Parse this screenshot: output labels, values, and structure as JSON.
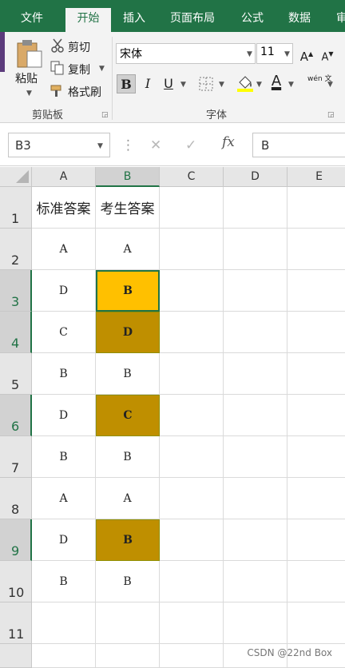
{
  "ribbon_tabs": [
    "文件",
    "开始",
    "插入",
    "页面布局",
    "公式",
    "数据",
    "审"
  ],
  "active_tab": "开始",
  "clipboard": {
    "paste_label": "粘贴",
    "cut_label": "剪切",
    "copy_label": "复制",
    "format_painter_label": "格式刷",
    "group_label": "剪贴板"
  },
  "font": {
    "name": "宋体",
    "size": "11",
    "bold_label": "B",
    "italic_label": "I",
    "underline_label": "U",
    "font_color_label": "A",
    "phonetic_label": "wén 文",
    "group_label": "字体"
  },
  "formula_bar": {
    "name_box": "B3",
    "fx_label": "fx",
    "value": "B"
  },
  "columns": [
    "A",
    "B",
    "C",
    "D",
    "E"
  ],
  "rows": [
    {
      "num": "1",
      "a": "标准答案",
      "b": "考生答案"
    },
    {
      "num": "2",
      "a": "A",
      "b": "A"
    },
    {
      "num": "3",
      "a": "D",
      "b": "B"
    },
    {
      "num": "4",
      "a": "C",
      "b": "D"
    },
    {
      "num": "5",
      "a": "B",
      "b": "B"
    },
    {
      "num": "6",
      "a": "D",
      "b": "C"
    },
    {
      "num": "7",
      "a": "B",
      "b": "B"
    },
    {
      "num": "8",
      "a": "A",
      "b": "A"
    },
    {
      "num": "9",
      "a": "D",
      "b": "B"
    },
    {
      "num": "10",
      "a": "B",
      "b": "B"
    },
    {
      "num": "11",
      "a": "",
      "b": ""
    }
  ],
  "colors": {
    "ribbon_green": "#217346",
    "mismatch_fill": "#bf8f00",
    "active_mismatch_fill": "#ffc000"
  },
  "watermark": "CSDN @22nd Box"
}
